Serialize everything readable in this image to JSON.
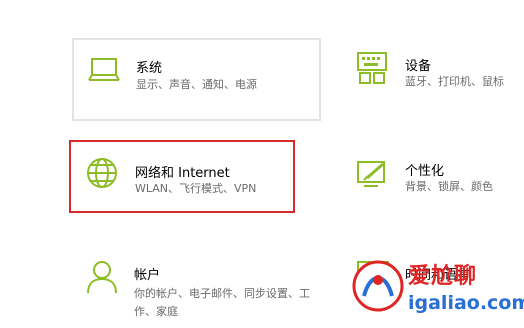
{
  "accent_color": "#8cbc26",
  "tiles": {
    "system": {
      "title": "系统",
      "desc": "显示、声音、通知、电源",
      "icon": "laptop-icon"
    },
    "devices": {
      "title": "设备",
      "desc": "蓝牙、打印机、鼠标",
      "icon": "keyboard-icon"
    },
    "network": {
      "title": "网络和 Internet",
      "desc": "WLAN、飞行模式、VPN",
      "icon": "globe-icon"
    },
    "personalization": {
      "title": "个性化",
      "desc": "背景、锁屏、颜色",
      "icon": "paint-icon"
    },
    "accounts": {
      "title": "帐户",
      "desc": "你的帐户、电子邮件、同步设置、工作、家庭",
      "icon": "person-icon"
    },
    "time_language": {
      "title": "时间和语言",
      "desc": "",
      "icon": "language-icon"
    }
  },
  "watermark": {
    "text": "爱尬聊",
    "url": "igaliao.com"
  }
}
